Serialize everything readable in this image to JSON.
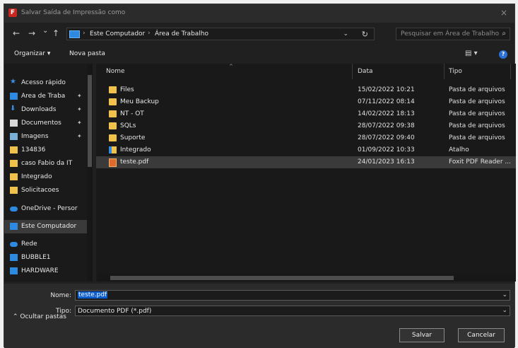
{
  "window": {
    "title": "Salvar Saída de Impressão como",
    "app_icon": "foxit-icon",
    "close_label": "×"
  },
  "nav": {
    "back": "←",
    "forward": "→",
    "recent": "⌄",
    "up": "↑"
  },
  "address": {
    "crumbs": [
      "Este Computador",
      "Área de Trabalho"
    ],
    "separator": "›",
    "dropdown": "⌄",
    "refresh": "↻"
  },
  "search": {
    "placeholder": "Pesquisar em Área de Trabalho",
    "icon": "⌕"
  },
  "toolbar": {
    "organize_label": "Organizar ▾",
    "new_folder_label": "Nova pasta",
    "view_label": "▤ ▾",
    "help_label": "?"
  },
  "sidebar": {
    "items": [
      {
        "label": "Acesso rápido",
        "icon": "star-icon",
        "color": "#3b8ee8",
        "pinned": false
      },
      {
        "label": "Área de Traba",
        "icon": "desktop-icon",
        "color": "#2d8ae0",
        "pinned": true
      },
      {
        "label": "Downloads",
        "icon": "download-icon",
        "color": "#3b8ee8",
        "pinned": true
      },
      {
        "label": "Documentos",
        "icon": "document-icon",
        "color": "#d9d9d9",
        "pinned": true
      },
      {
        "label": "Imagens",
        "icon": "image-icon",
        "color": "#7ab0d8",
        "pinned": true
      },
      {
        "label": "134836",
        "icon": "folder-icon",
        "color": "#f0c24c",
        "pinned": false
      },
      {
        "label": "caso Fabio da IT",
        "icon": "folder-icon",
        "color": "#f0c24c",
        "pinned": false
      },
      {
        "label": "Integrado",
        "icon": "folder-icon",
        "color": "#f0c24c",
        "pinned": false
      },
      {
        "label": "Solicitacoes",
        "icon": "folder-icon",
        "color": "#f0c24c",
        "pinned": false
      },
      {
        "label": "OneDrive - Persor",
        "icon": "cloud-icon",
        "color": "#2d8ae0",
        "pinned": false
      },
      {
        "label": "Este Computador",
        "icon": "computer-icon",
        "color": "#2d8ae0",
        "pinned": false,
        "selected": true
      },
      {
        "label": "Rede",
        "icon": "network-icon",
        "color": "#2d8ae0",
        "pinned": false
      },
      {
        "label": "BUBBLE1",
        "icon": "computer-icon",
        "color": "#2d8ae0",
        "pinned": false
      },
      {
        "label": "HARDWARE",
        "icon": "computer-icon",
        "color": "#2d8ae0",
        "pinned": false
      }
    ],
    "pin_glyph": "✦"
  },
  "columns": {
    "name": "Nome",
    "date": "Data",
    "type": "Tipo"
  },
  "files": [
    {
      "name": "Files",
      "date": "15/02/2022 10:21",
      "type": "Pasta de arquivos",
      "icon": "folder-icon"
    },
    {
      "name": "Meu Backup",
      "date": "07/11/2022 08:14",
      "type": "Pasta de arquivos",
      "icon": "folder-icon"
    },
    {
      "name": "NT - OT",
      "date": "14/02/2022 18:13",
      "type": "Pasta de arquivos",
      "icon": "folder-icon"
    },
    {
      "name": "SQLs",
      "date": "28/07/2022 09:38",
      "type": "Pasta de arquivos",
      "icon": "folder-icon"
    },
    {
      "name": "Suporte",
      "date": "28/07/2022 09:40",
      "type": "Pasta de arquivos",
      "icon": "folder-icon"
    },
    {
      "name": "Integrado",
      "date": "01/09/2022 10:33",
      "type": "Atalho",
      "icon": "shortcut-folder-icon"
    },
    {
      "name": "teste.pdf",
      "date": "24/01/2023 16:13",
      "type": "Foxit PDF Reader ...",
      "icon": "pdf-file-icon",
      "selected": true
    }
  ],
  "form": {
    "name_label": "Nome:",
    "name_value": "teste.pdf",
    "type_label": "Tipo:",
    "type_value": "Documento PDF (*.pdf)",
    "dropdown": "⌄"
  },
  "footer": {
    "hide_folders_label": "⌃  Ocultar pastas",
    "save_label": "Salvar",
    "cancel_label": "Cancelar"
  },
  "colors": {
    "accent": "#0a5bcc",
    "folder": "#f0c24c",
    "background": "#202020"
  }
}
